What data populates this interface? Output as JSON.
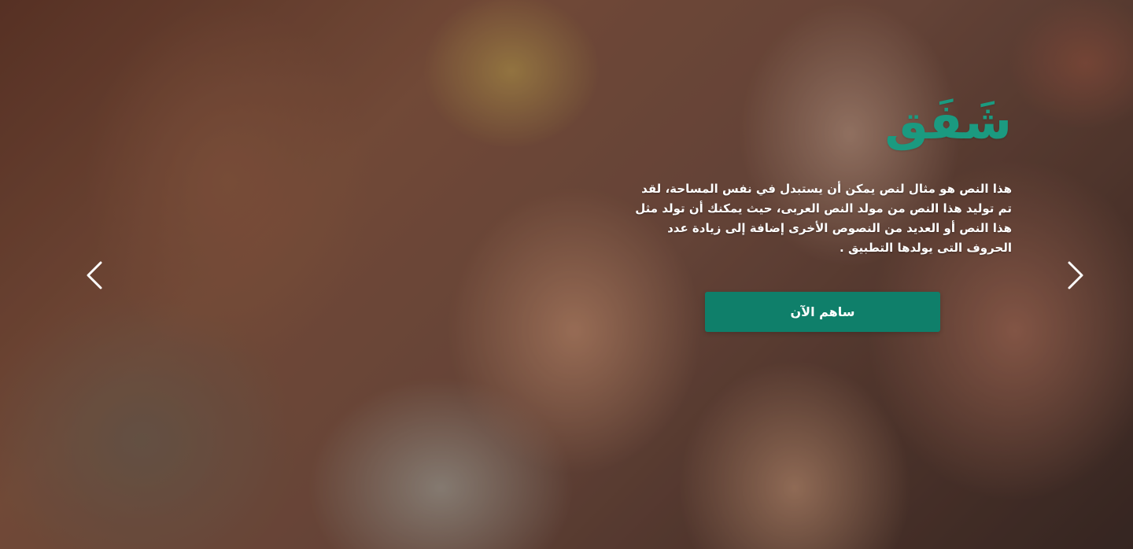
{
  "hero": {
    "title": "شَفَق",
    "description": "هذا النص هو مثال لنص يمكن أن يستبدل في نفس المساحة، لقد تم توليد هذا النص من مولد النص العربى، حيث يمكنك أن تولد مثل هذا النص أو العديد من النصوص الأخرى إضافة إلى زيادة عدد الحروف التى يولدها التطبيق .",
    "cta_label": "ساهم الآن"
  },
  "carousel": {
    "prev_icon": "chevron-left-icon",
    "next_icon": "chevron-right-icon"
  },
  "colors": {
    "brand": "#1b9a80",
    "button": "#0f7f6a",
    "text": "#ffffff"
  }
}
